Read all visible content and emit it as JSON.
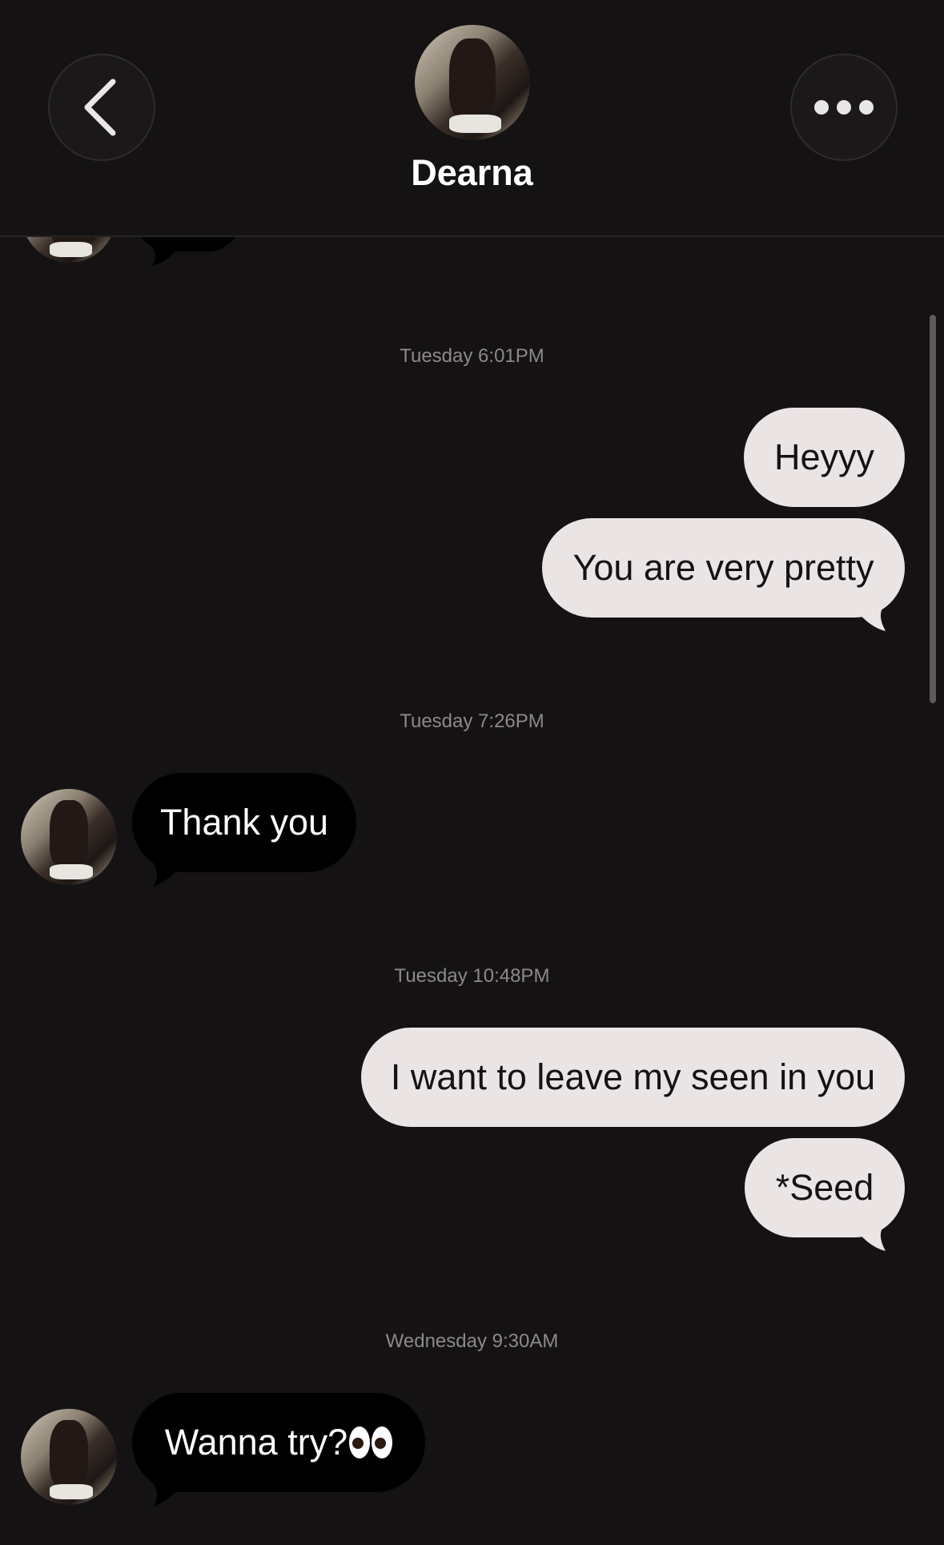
{
  "header": {
    "contact_name": "Dearna",
    "back_icon": "chevron-left-icon",
    "more_icon": "more-horizontal-icon"
  },
  "messages": [
    {
      "type": "timestamp",
      "text": "Tuesday 6:01PM"
    },
    {
      "type": "outgoing",
      "text": "Heyyy"
    },
    {
      "type": "outgoing",
      "text": "You are very pretty"
    },
    {
      "type": "timestamp",
      "text": "Tuesday 7:26PM"
    },
    {
      "type": "incoming",
      "text": "Thank you"
    },
    {
      "type": "timestamp",
      "text": "Tuesday 10:48PM"
    },
    {
      "type": "outgoing",
      "text": "I want to leave my seen in you"
    },
    {
      "type": "outgoing",
      "text": "*Seed"
    },
    {
      "type": "timestamp",
      "text": "Wednesday 9:30AM"
    },
    {
      "type": "incoming",
      "text": "Wanna try?",
      "emoji": "eyes"
    }
  ],
  "colors": {
    "background": "#141213",
    "outgoing_bubble": "#ebe4e5",
    "incoming_bubble": "#000000",
    "timestamp": "#8c898a"
  }
}
